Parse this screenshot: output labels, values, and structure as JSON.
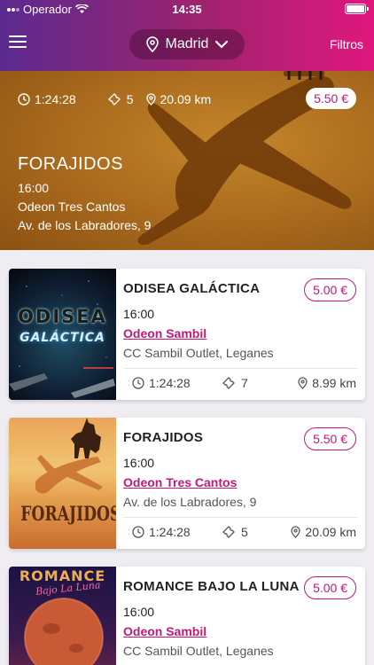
{
  "status_bar": {
    "carrier": "Operador",
    "time": "14:35"
  },
  "header": {
    "city": "Madrid",
    "filters_label": "Filtros"
  },
  "featured": {
    "duration": "1:24:28",
    "tickets": "5",
    "distance": "20.09 km",
    "price": "5.50 €",
    "title": "FORAJIDOS",
    "time": "16:00",
    "cinema": "Odeon Tres Cantos",
    "address": "Av. de los Labradores, 9"
  },
  "cards": [
    {
      "poster_text": [
        "ODISEA",
        "GALÁCTICA"
      ],
      "title": "ODISEA GALÁCTICA",
      "price": "5.00 €",
      "time": "16:00",
      "cinema": "Odeon Sambil",
      "address": "CC Sambil Outlet, Leganes",
      "duration": "1:24:28",
      "tickets": "7",
      "distance": "8.99 km"
    },
    {
      "poster_text": [
        "FORAJIDOS"
      ],
      "title": "FORAJIDOS",
      "price": "5.50 €",
      "time": "16:00",
      "cinema": "Odeon Tres Cantos",
      "address": "Av. de los Labradores, 9",
      "duration": "1:24:28",
      "tickets": "5",
      "distance": "20.09 km"
    },
    {
      "poster_text": [
        "ROMANCE",
        "Bajo La Luna"
      ],
      "title": "ROMANCE BAJO LA LUNA",
      "price": "5.00 €",
      "time": "16:00",
      "cinema": "Odeon Sambil",
      "address": "CC Sambil Outlet, Leganes"
    }
  ],
  "colors": {
    "accent": "#c2187a",
    "header_start": "#5b2a8e",
    "header_end": "#e0177d",
    "hero": "#a8691d"
  },
  "icons": [
    "menu-icon",
    "location-pin-icon",
    "chevron-down-icon",
    "clock-icon",
    "ticket-icon",
    "wifi-icon",
    "battery-icon"
  ]
}
